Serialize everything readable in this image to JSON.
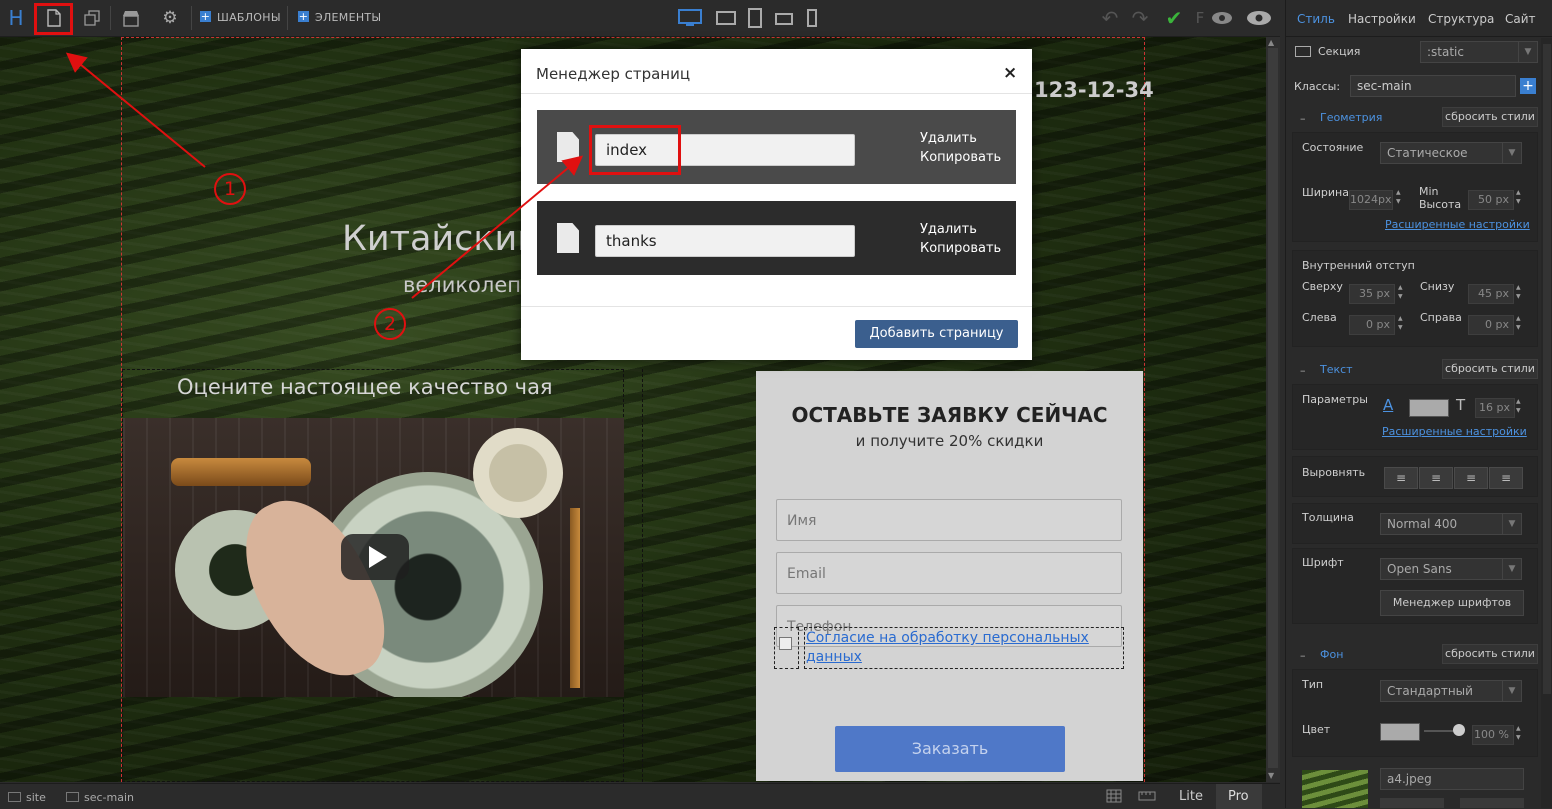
{
  "toolbar": {
    "logo": "H",
    "templates_label": "ШАБЛОНЫ",
    "elements_label": "ЭЛЕМЕНТЫ",
    "f_label": "F"
  },
  "canvas": {
    "phone": "123-12-34",
    "hero_title": "Китайский",
    "hero_sub": "великолепи",
    "quality_title": "Оцените настоящее качество чая",
    "form": {
      "title": "ОСТАВЬТЕ ЗАЯВКУ СЕЙЧАС",
      "subtitle": "и получите 20% скидки",
      "name_placeholder": "Имя",
      "email_placeholder": "Email",
      "phone_placeholder": "Телефон",
      "consent": "Согласие на обработку персональных данных",
      "submit": "Заказать"
    }
  },
  "modal": {
    "title": "Менеджер страниц",
    "close": "×",
    "pages": [
      {
        "name": "index",
        "delete": "Удалить",
        "copy": "Копировать"
      },
      {
        "name": "thanks",
        "delete": "Удалить",
        "copy": "Копировать"
      }
    ],
    "add_button": "Добавить страницу"
  },
  "annotations": {
    "one": "1",
    "two": "2"
  },
  "bottombar": {
    "site": "site",
    "section": "sec-main",
    "lite": "Lite",
    "pro": "Pro"
  },
  "right_panel": {
    "tabs": [
      "Стиль",
      "Настройки",
      "Структура",
      "Сайт"
    ],
    "section_label": "Секция",
    "position_value": ":static",
    "classes_label": "Классы:",
    "class_value": "sec-main",
    "geometry": {
      "title": "Геометрия",
      "reset": "сбросить стили",
      "state_label": "Состояние",
      "state_value": "Статическое",
      "width_label": "Ширина",
      "width_value": "1024px",
      "min_height_label": "Min Высота",
      "min_height_value": "50",
      "min_height_unit": "px",
      "advanced": "Расширенные настройки"
    },
    "padding": {
      "title": "Внутренний отступ",
      "top_label": "Сверху",
      "top_value": "35",
      "bottom_label": "Снизу",
      "bottom_value": "45",
      "left_label": "Слева",
      "left_value": "0",
      "right_label": "Справа",
      "right_value": "0",
      "unit": "px"
    },
    "text": {
      "title": "Текст",
      "reset": "сбросить стили",
      "params_label": "Параметры",
      "font_size": "16",
      "font_unit": "px",
      "advanced": "Расширенные настройки",
      "align_label": "Выровнять",
      "weight_label": "Толщина",
      "weight_value": "Normal 400",
      "font_label": "Шрифт",
      "font_value": "Open Sans",
      "font_manager": "Менеджер шрифтов"
    },
    "background": {
      "title": "Фон",
      "reset": "сбросить стили",
      "type_label": "Тип",
      "type_value": "Стандартный",
      "color_label": "Цвет",
      "opacity": "100",
      "opacity_unit": "%",
      "image_name": "a4.jpeg"
    }
  },
  "colors": {
    "accent": "#4c92e0",
    "annotation": "#e01010",
    "modal_row_active": "#4a4a4a",
    "modal_row": "#2c2c2c",
    "add_button": "#3b5f8e",
    "order_button": "#4f78c8"
  }
}
